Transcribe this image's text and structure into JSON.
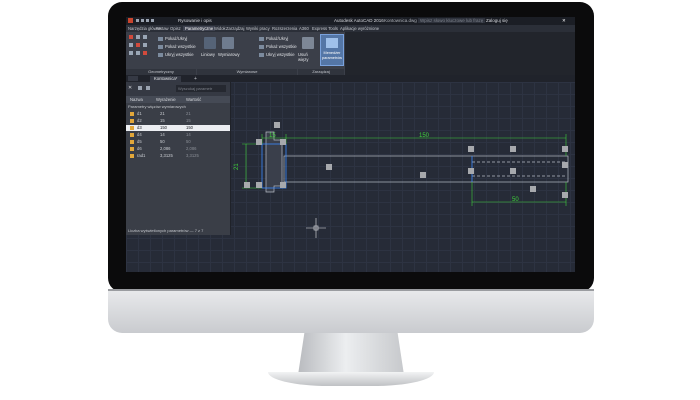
{
  "titlebar": {
    "workspace": "Rysowanie i opis",
    "app_title": "Autodesk AutoCAD 2016",
    "file_name": "Kontownica.dwg",
    "search_placeholder": "Wpisz słowo kluczowe lub frazę",
    "signin": "Zaloguj się"
  },
  "tabs": [
    "Narzędzia główne",
    "Wstaw",
    "Opisz",
    "Parametryczne",
    "Widok",
    "Zarządzaj",
    "Wyniki pracy",
    "Rozszerzenia",
    "A360",
    "Express Tools",
    "Aplikacje wyróżnione"
  ],
  "active_tab": "Parametryczne",
  "ribbon": {
    "geom_buttons": [
      "Pokaż/Ukryj",
      "Pokaż wszystkie",
      "Ukryj wszystkie"
    ],
    "dim_big": [
      "Liniowy",
      "Wymiarowy"
    ],
    "dim_buttons": [
      "Pokaż/Ukryj",
      "Pokaż wszystkie",
      "Ukryj wszystkie"
    ],
    "manage_big": [
      "Usuń więzy",
      "Menedżer parametrów"
    ],
    "panels": [
      "Geometryczny",
      "Wymiarowe",
      "Zarządzaj"
    ]
  },
  "file_tab": "Kontownica*",
  "param_manager": {
    "search_placeholder": "Wyszukaj parametr",
    "columns": [
      "Nazwa",
      "Wyrażenie",
      "Wartość"
    ],
    "group": "Parametry więzów wymiarowych",
    "rows": [
      {
        "name": "d1",
        "expr": "21",
        "value": "21"
      },
      {
        "name": "d2",
        "expr": "15",
        "value": "15"
      },
      {
        "name": "d3",
        "expr": "150",
        "value": "150"
      },
      {
        "name": "d4",
        "expr": "14",
        "value": "14"
      },
      {
        "name": "d5",
        "expr": "50",
        "value": "50"
      },
      {
        "name": "d6",
        "expr": "2,086",
        "value": "2,086"
      },
      {
        "name": "rad1",
        "expr": "3,3125",
        "value": "3,3125"
      }
    ],
    "selected_index": 2,
    "status": "Liczba wyświetlonych parametrów — 7 z 7"
  },
  "dimensions": {
    "top_left": "15",
    "top_right": "150",
    "left": "21",
    "bottom_right": "50"
  },
  "colors": {
    "canvas_bg": "#262b37",
    "dimension": "#3fd13a",
    "geometry_selected": "#3d8bff",
    "grip": "#a7a9ad"
  }
}
